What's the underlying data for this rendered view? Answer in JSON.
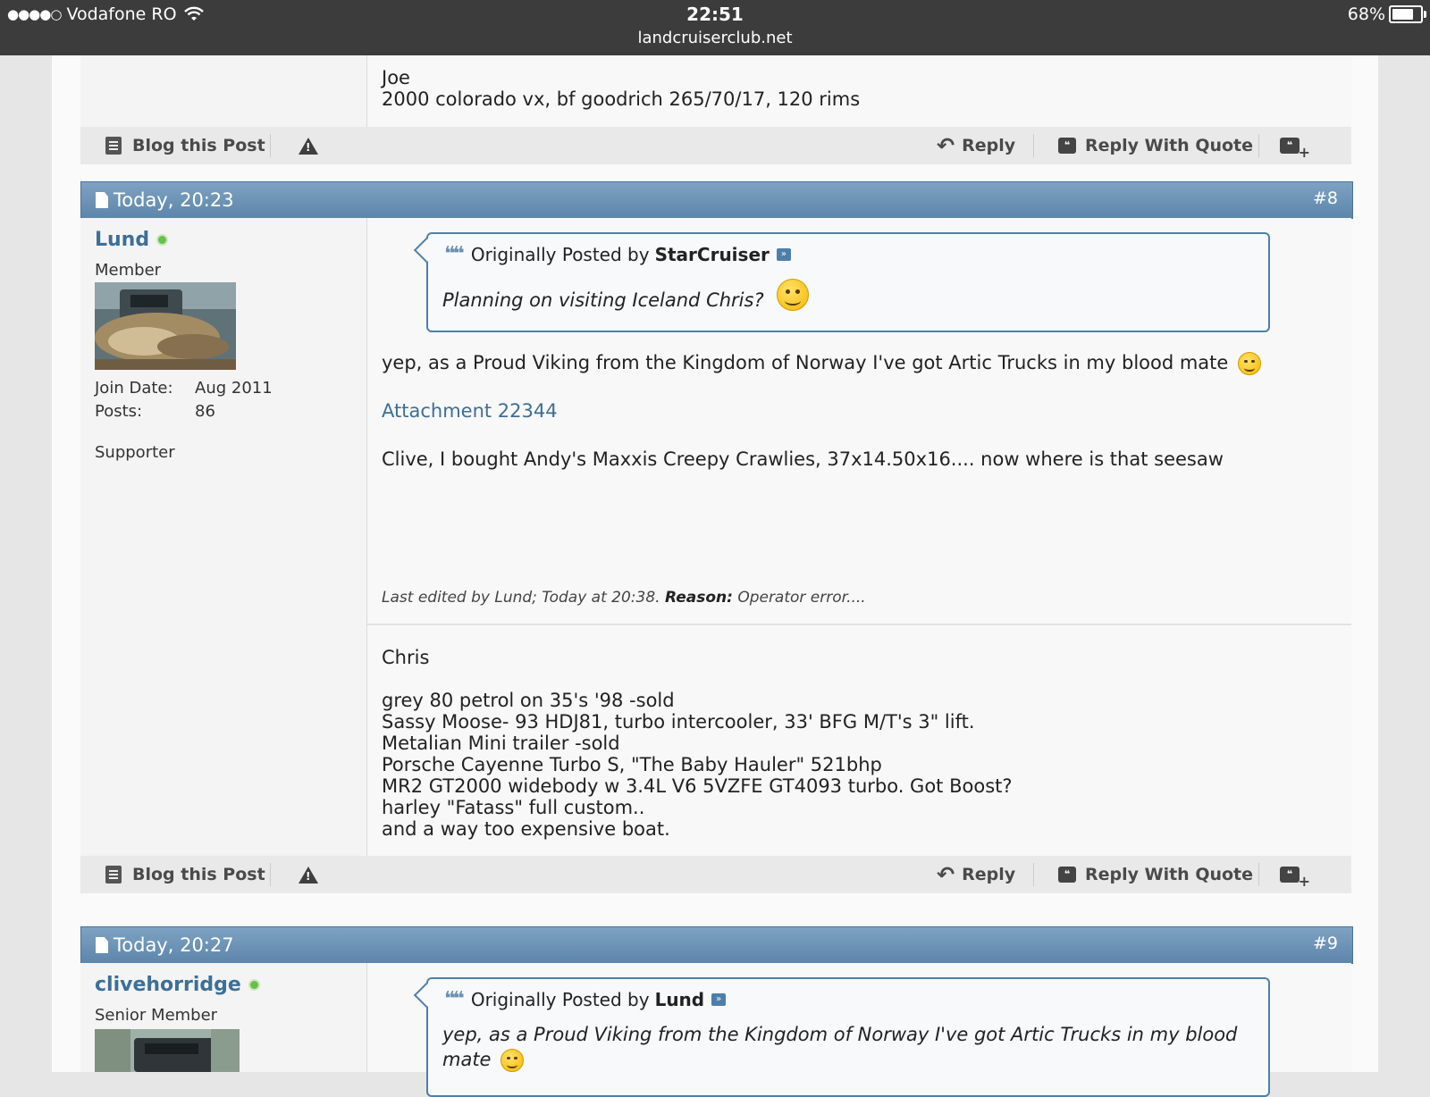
{
  "status_bar": {
    "carrier": "Vodafone RO",
    "signal_dots": "●●●●○",
    "time": "22:51",
    "url": "landcruiserclub.net",
    "battery": "68%",
    "battery_level": 0.68
  },
  "prev_post": {
    "signature_lines": [
      "Joe",
      "2000 colorado vx, bf goodrich 265/70/17, 120 rims"
    ]
  },
  "post_actions": {
    "blog": "Blog this Post",
    "reply": "Reply",
    "reply_quote": "Reply With Quote"
  },
  "post8": {
    "date": "Today, 20:23",
    "number": "#8",
    "username": "Lund",
    "user_title": "Member",
    "join_label": "Join Date:",
    "join_value": "Aug 2011",
    "posts_label": "Posts:",
    "posts_value": "86",
    "extra": "Supporter",
    "quote_prefix": "Originally Posted by",
    "quote_author": "StarCruiser",
    "quote_text": "Planning on visiting Iceland Chris?",
    "message1": "yep, as a Proud Viking from the Kingdom of Norway I've got Artic Trucks in my blood mate",
    "attachment": "Attachment 22344",
    "message2": "Clive, I bought Andy's Maxxis Creepy Crawlies, 37x14.50x16.... now where is that seesaw",
    "edited_prefix": "Last edited by Lund; Today at 20:38.",
    "edited_reason_label": "Reason:",
    "edited_reason": "Operator error....",
    "signature": {
      "name": "Chris",
      "lines": [
        "grey 80 petrol on 35's '98 -sold",
        "Sassy Moose- 93 HDJ81, turbo intercooler, 33' BFG M/T's 3\" lift.",
        "Metalian Mini trailer -sold",
        "Porsche Cayenne Turbo S, \"The Baby Hauler\" 521bhp",
        "MR2 GT2000 widebody w 3.4L V6 5VZFE GT4093 turbo. Got Boost?",
        "harley \"Fatass\" full custom..",
        "and a way too expensive boat."
      ]
    }
  },
  "post9": {
    "date": "Today, 20:27",
    "number": "#9",
    "username": "clivehorridge",
    "user_title": "Senior Member",
    "quote_prefix": "Originally Posted by",
    "quote_author": "Lund",
    "quote_text_line1": "yep, as a Proud Viking from the Kingdom of Norway I've got Artic Trucks in my blood",
    "quote_text_line2": "mate"
  },
  "icons": {
    "blog": "blog-icon",
    "report": "warning-icon",
    "reply": "reply-arrow-icon",
    "quote": "quote-bubble-icon",
    "multiquote": "multiquote-icon",
    "online": "online-status-icon",
    "smile": "smile-emoji-icon",
    "wink": "wink-emoji-icon"
  },
  "colors": {
    "header_bar": "#6a91b5",
    "link": "#3d6f97",
    "status_bar": "#3c3c3c"
  }
}
